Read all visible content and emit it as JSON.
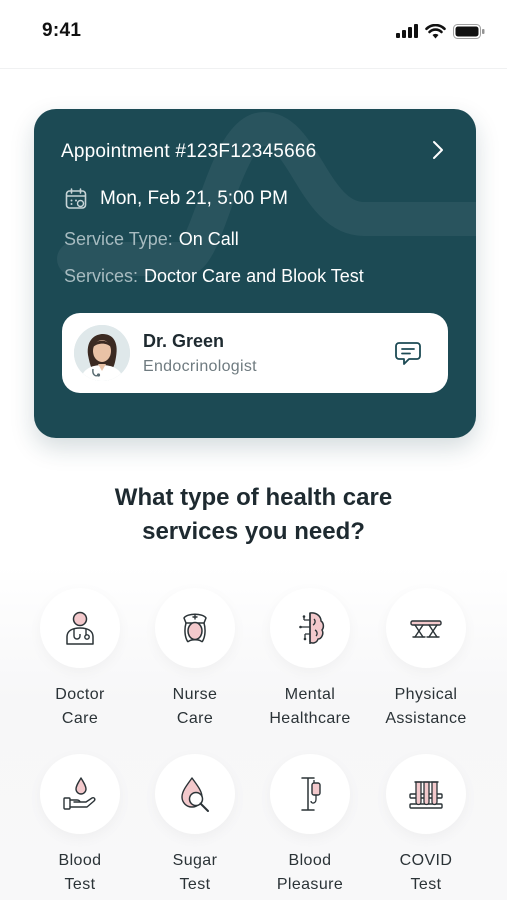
{
  "status_bar": {
    "time": "9:41",
    "icons": [
      "cellular-signal-icon",
      "wifi-icon",
      "battery-icon"
    ]
  },
  "appointment": {
    "title": "Appointment #123F12345666",
    "datetime": "Mon, Feb 21, 5:00 PM",
    "service_type_label": "Service Type:",
    "service_type_value": "On Call",
    "services_label": "Services:",
    "services_value": "Doctor Care and Blook Test",
    "doctor": {
      "name": "Dr. Green",
      "specialty": "Endocrinologist"
    },
    "colors": {
      "card": "#1c4a54",
      "label": "#a7bbc0"
    }
  },
  "question": {
    "line1": "What type of health care",
    "line2": "services you need?"
  },
  "services": [
    {
      "line1": "Doctor",
      "line2": "Care",
      "icon": "doctor-icon"
    },
    {
      "line1": "Nurse",
      "line2": "Care",
      "icon": "nurse-icon"
    },
    {
      "line1": "Mental",
      "line2": "Healthcare",
      "icon": "brain-icon"
    },
    {
      "line1": "Physical",
      "line2": "Assistance",
      "icon": "massage-table-icon"
    },
    {
      "line1": "Blood",
      "line2": "Test",
      "icon": "blood-drop-hand-icon"
    },
    {
      "line1": "Sugar",
      "line2": "Test",
      "icon": "sugar-drop-magnifier-icon"
    },
    {
      "line1": "Blood",
      "line2": "Pleasure",
      "icon": "iv-drip-icon"
    },
    {
      "line1": "COVID",
      "line2": "Test",
      "icon": "test-tubes-icon"
    }
  ],
  "accent_color": "#f3c9cc"
}
